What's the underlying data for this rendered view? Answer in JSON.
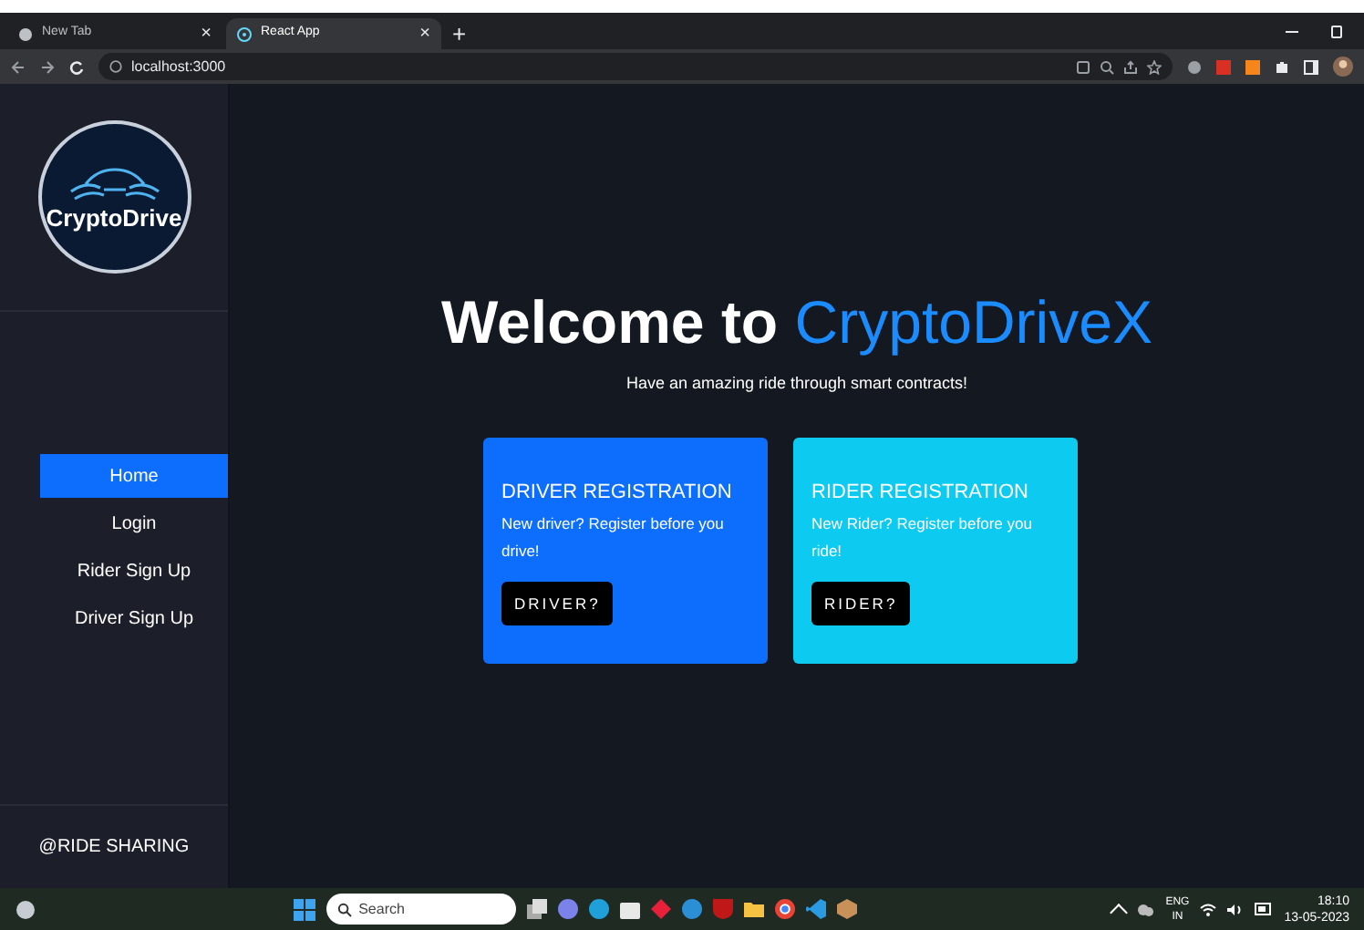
{
  "browser": {
    "tabs": [
      {
        "title": "New Tab",
        "close": "×",
        "selected": false
      },
      {
        "title": "React App",
        "close": "×",
        "selected": true
      }
    ],
    "new_tab": "+",
    "address": "localhost:3000"
  },
  "sidebar": {
    "logo_text": "CryptoDrive",
    "items": [
      {
        "label": "Home",
        "selected": true
      },
      {
        "label": "Login",
        "selected": false
      },
      {
        "label": "Rider Sign Up",
        "selected": false
      },
      {
        "label": "Driver Sign Up",
        "selected": false
      }
    ],
    "footer": "@RIDE SHARING"
  },
  "hero": {
    "title_start": "Welcome to ",
    "title_brand": "CryptoDriveX",
    "subtitle": "Have an amazing ride through smart contracts!"
  },
  "cards": [
    {
      "title": "DRIVER REGISTRATION",
      "text": "New driver? Register before you drive!",
      "button": "DRIVER?",
      "color": "#0d6efd"
    },
    {
      "title": "RIDER REGISTRATION",
      "text": "New Rider? Register before you ride!",
      "button": "RIDER?",
      "color": "#0dcaf0"
    }
  ],
  "taskbar": {
    "search": "Search",
    "lang": "ENG",
    "region": "IN",
    "time": "18:10",
    "date": "13-05-2023"
  }
}
